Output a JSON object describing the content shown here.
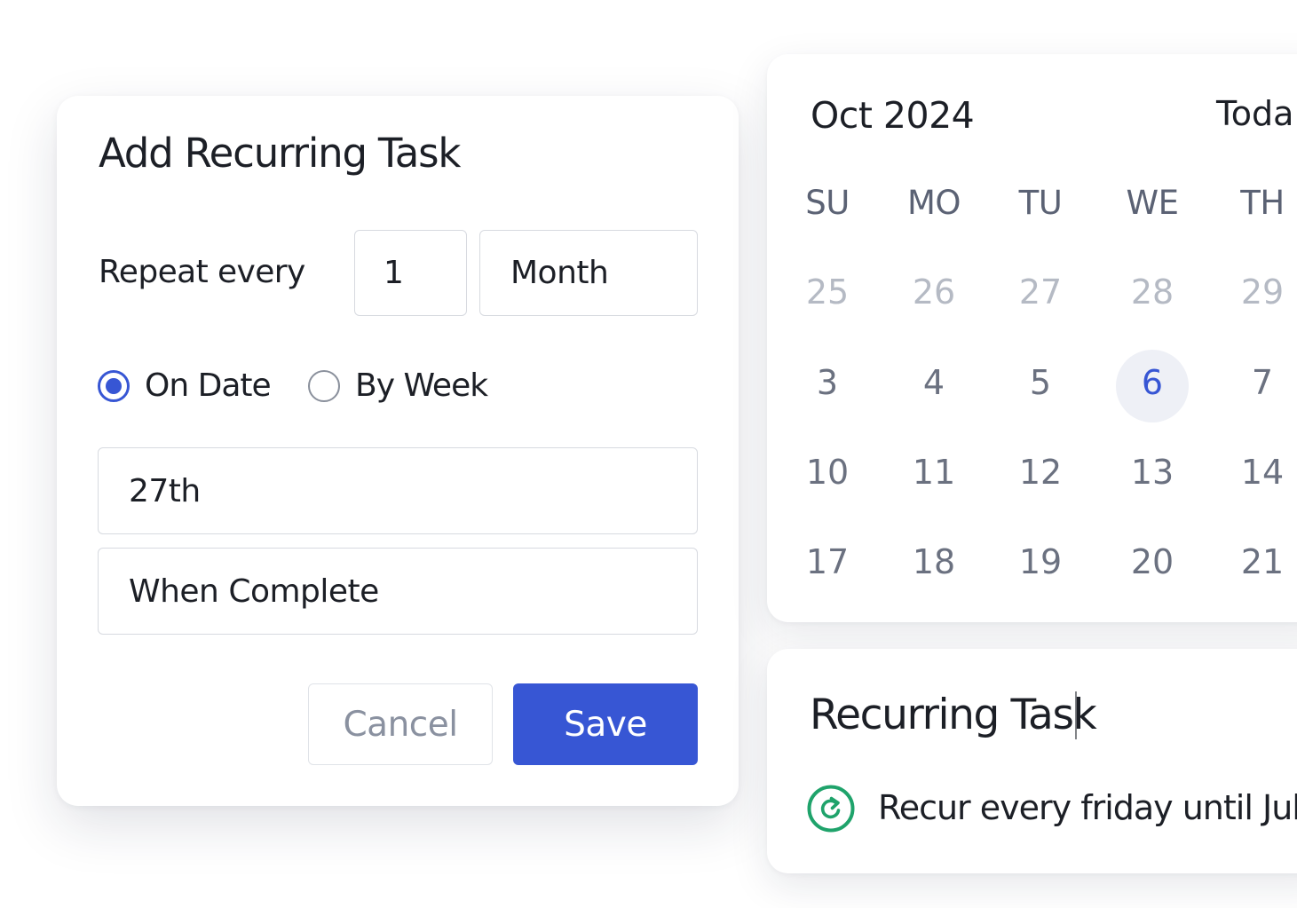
{
  "dialog": {
    "title": "Add Recurring Task",
    "repeat_label": "Repeat every",
    "repeat_count": "1",
    "repeat_unit": "Month",
    "options": [
      {
        "label": "On Date",
        "selected": true
      },
      {
        "label": "By Week",
        "selected": false
      }
    ],
    "day_value": "27th",
    "condition_value": "When Complete",
    "cancel_label": "Cancel",
    "save_label": "Save"
  },
  "calendar": {
    "month_label": "Oct 2024",
    "today_label": "Toda",
    "weekdays": [
      "SU",
      "MO",
      "TU",
      "WE",
      "TH"
    ],
    "weeks": [
      [
        "25",
        "26",
        "27",
        "28",
        "29"
      ],
      [
        "3",
        "4",
        "5",
        "6",
        "7"
      ],
      [
        "10",
        "11",
        "12",
        "13",
        "14"
      ],
      [
        "17",
        "18",
        "19",
        "20",
        "21"
      ]
    ],
    "today_day": "6"
  },
  "task": {
    "title": "Recurring Task",
    "rule": "Recur every friday until Jul",
    "icon": "recurring-icon"
  },
  "colors": {
    "accent": "#3756d4",
    "recur_icon": "#1fa36b",
    "text": "#1c1f26",
    "muted": "#6b7180",
    "faded": "#b5bac4",
    "today_bg": "#eef0f6"
  }
}
